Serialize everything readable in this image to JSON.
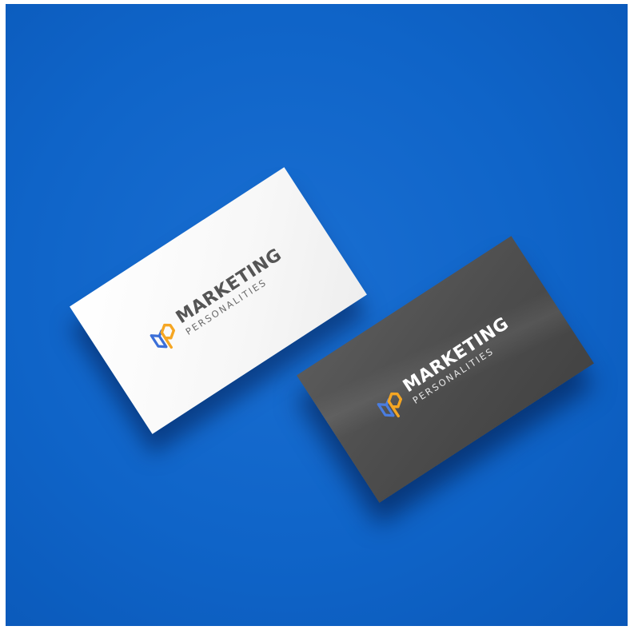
{
  "scene": {
    "background_color": "#0f64c8",
    "cards": [
      {
        "variant": "white",
        "card_color": "#ffffff",
        "logo": {
          "primary": "MARKETING",
          "secondary": "PERSONALITIES",
          "icon": "mp-monogram-icon",
          "colors": {
            "blue": "#3b6fd8",
            "orange": "#f5a623",
            "text": "#555555"
          }
        }
      },
      {
        "variant": "dark",
        "card_color": "#4e4e4e",
        "logo": {
          "primary": "MARKETING",
          "secondary": "PERSONALITIES",
          "icon": "mp-monogram-icon",
          "colors": {
            "blue": "#3b6fd8",
            "orange": "#f5a623",
            "text": "#ffffff"
          }
        }
      }
    ]
  }
}
